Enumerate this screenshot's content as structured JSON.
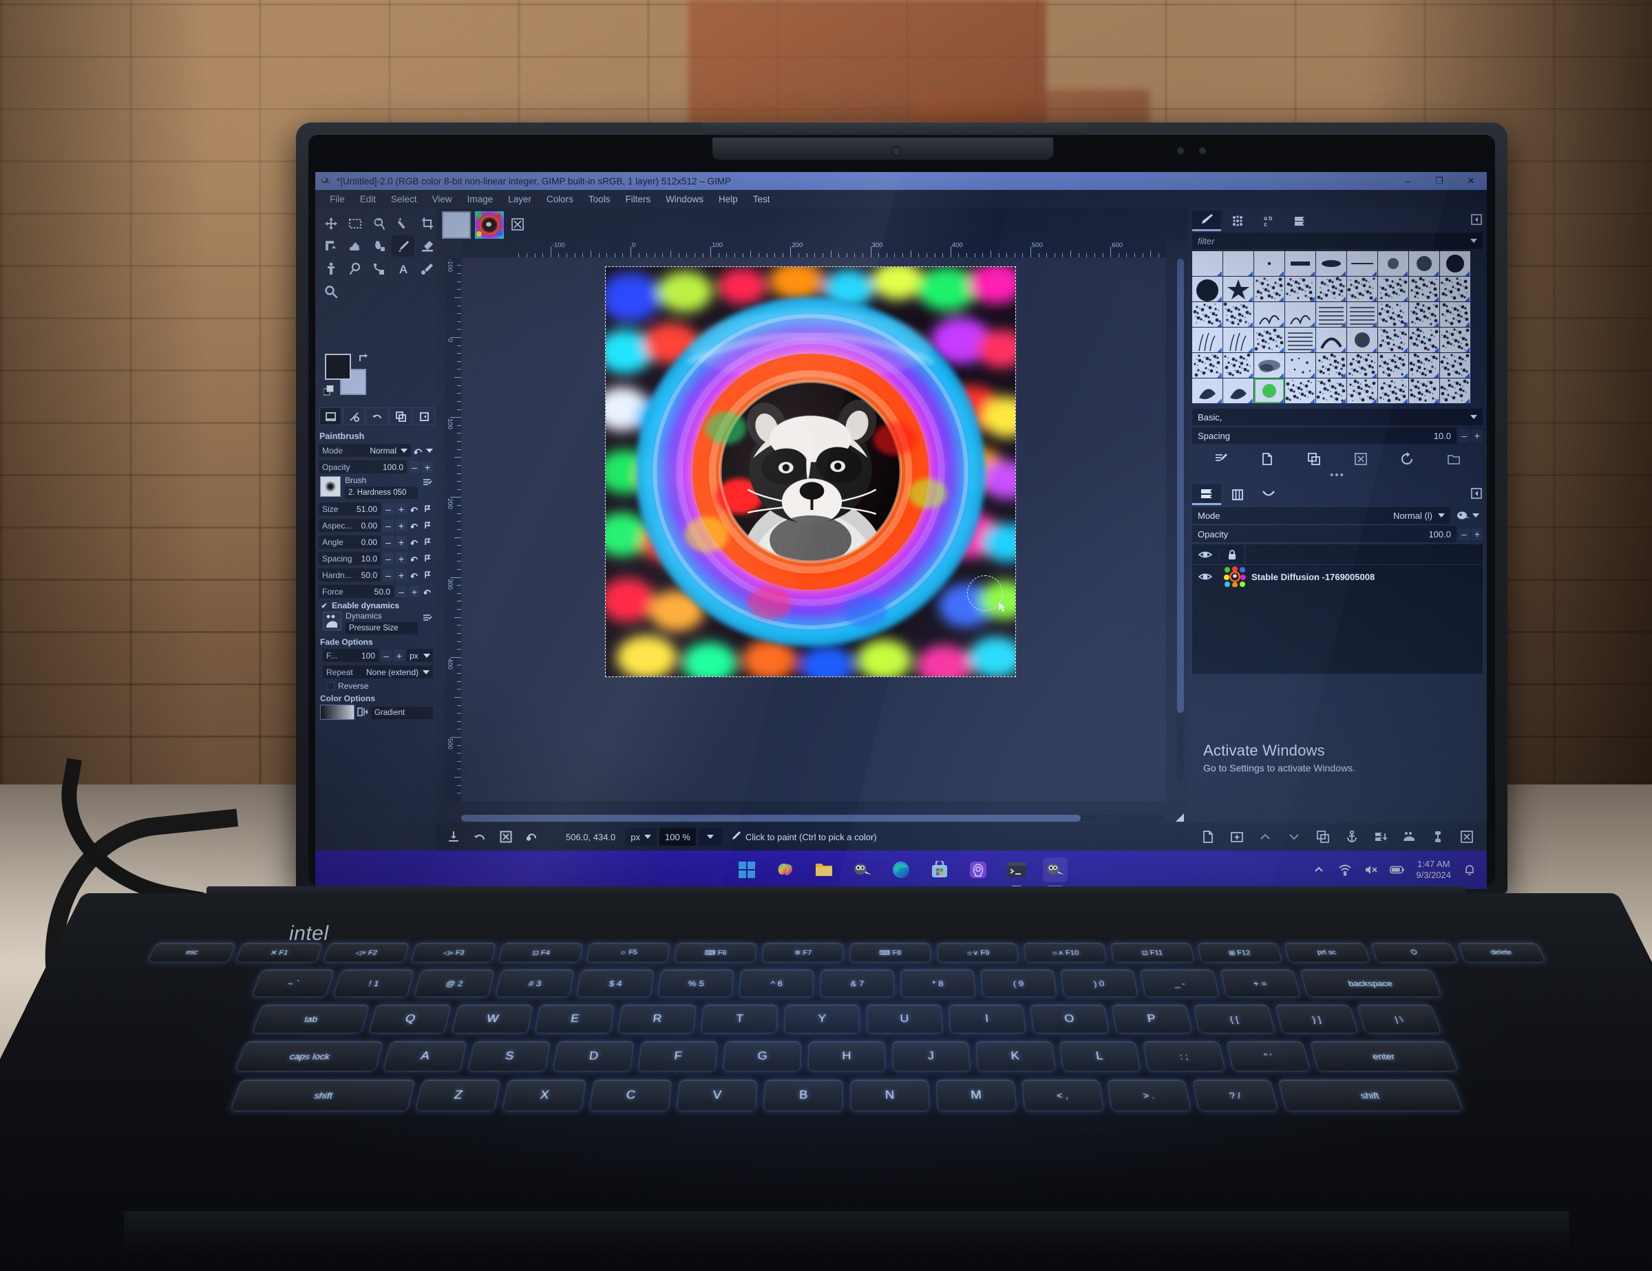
{
  "window": {
    "title": "*[Untitled]-2.0 (RGB color 8-bit non-linear integer, GIMP built-in sRGB, 1 layer) 512x512 – GIMP",
    "minimize": "–",
    "maximize": "❐",
    "close": "✕"
  },
  "menubar": {
    "items": [
      "File",
      "Edit",
      "Select",
      "View",
      "Image",
      "Layer",
      "Colors",
      "Tools",
      "Filters",
      "Windows",
      "Help",
      "Test"
    ]
  },
  "toolbox": {
    "tools": [
      {
        "name": "move-tool",
        "label": "Move"
      },
      {
        "name": "rectangle-select-tool",
        "label": "Rectangle Select"
      },
      {
        "name": "free-select-tool",
        "label": "Free Select"
      },
      {
        "name": "fuzzy-select-tool",
        "label": "Fuzzy Select"
      },
      {
        "name": "crop-tool",
        "label": "Crop"
      },
      {
        "name": "transform-tool",
        "label": "Unified Transform"
      },
      {
        "name": "bucket-fill-tool",
        "label": "Bucket Fill"
      },
      {
        "name": "smudge-tool",
        "label": "Smudge"
      },
      {
        "name": "paintbrush-tool",
        "label": "Paintbrush"
      },
      {
        "name": "eraser-tool",
        "label": "Eraser"
      },
      {
        "name": "clone-tool",
        "label": "Clone"
      },
      {
        "name": "heal-tool",
        "label": "Heal"
      },
      {
        "name": "path-tool",
        "label": "Paths"
      },
      {
        "name": "text-tool",
        "label": "Text"
      },
      {
        "name": "color-picker-tool",
        "label": "Color Picker"
      },
      {
        "name": "zoom-tool",
        "label": "Zoom"
      }
    ],
    "active_tool": "paintbrush-tool",
    "colors": {
      "foreground": "#0a0f1c",
      "background": "#b6c9ef"
    },
    "quick_buttons": [
      "image-window",
      "quick-mask",
      "undo-history",
      "duplicate",
      "shrink-wrap"
    ]
  },
  "tool_options": {
    "title": "Paintbrush",
    "mode_label": "Mode",
    "mode_value": "Normal",
    "opacity_label": "Opacity",
    "opacity_value": "100.0",
    "brush_label": "Brush",
    "brush_name": "2. Hardness 050",
    "size_label": "Size",
    "size_value": "51.00",
    "aspect_label": "Aspec...",
    "aspect_value": "0.00",
    "angle_label": "Angle",
    "angle_value": "0.00",
    "spacing_label": "Spacing",
    "spacing_value": "10.0",
    "hardness_label": "Hardn...",
    "hardness_value": "50.0",
    "force_label": "Force",
    "force_value": "50.0",
    "enable_dynamics_label": "Enable dynamics",
    "enable_dynamics_checked": true,
    "dynamics_label": "Dynamics",
    "dynamics_value": "Pressure Size",
    "fade_options_label": "Fade Options",
    "fade_label": "F...",
    "fade_value": "100",
    "fade_unit": "px",
    "repeat_label": "Repeat",
    "repeat_value": "None (extend)",
    "reverse_label": "Reverse",
    "reverse_checked": false,
    "color_options_label": "Color Options",
    "gradient_label": "Gradient"
  },
  "canvas": {
    "ruler_h_labels": [
      "-100",
      "0",
      "100",
      "200",
      "300",
      "400",
      "500",
      "600"
    ],
    "ruler_v_labels": [
      "-100",
      "0",
      "100",
      "200",
      "300",
      "400",
      "500"
    ],
    "image_alt": "raccoon-in-candy-jar"
  },
  "statusbar": {
    "icons": [
      "save-icon",
      "undo-icon",
      "cancel-icon",
      "revert-icon"
    ],
    "position": "506.0, 434.0",
    "unit": "px",
    "zoom": "100 %",
    "hint": "Click to paint (Ctrl to pick a color)"
  },
  "right_dock": {
    "tabs": [
      {
        "name": "brushes-tab",
        "icon": "paintbrush-icon"
      },
      {
        "name": "patterns-tab",
        "icon": "pattern-icon"
      },
      {
        "name": "fonts-tab",
        "icon": "ab-icon"
      },
      {
        "name": "document-history-tab",
        "icon": "stack-icon"
      }
    ],
    "active_tab": "brushes-tab",
    "filter_placeholder": "filter",
    "brush_set_value": "Basic,",
    "spacing_label": "Spacing",
    "spacing_value": "10.0",
    "brush_action_icons": [
      "edit-brush-icon",
      "new-brush-icon",
      "duplicate-brush-icon",
      "delete-brush-icon",
      "refresh-brushes-icon",
      "open-folder-icon"
    ],
    "dots": "•••"
  },
  "layers": {
    "tabs": [
      {
        "name": "layers-tab",
        "icon": "layers-icon"
      },
      {
        "name": "channels-tab",
        "icon": "channels-icon"
      },
      {
        "name": "paths-tab",
        "icon": "paths-icon"
      }
    ],
    "active_tab": "layers-tab",
    "mode_label": "Mode",
    "mode_value": "Normal (l)",
    "opacity_label": "Opacity",
    "opacity_value": "100.0",
    "rows": [
      {
        "name": "Stable Diffusion -1769005008",
        "visible": true,
        "locked": false
      }
    ],
    "bottom_icons": [
      "new-layer-icon",
      "new-group-icon",
      "raise-layer-icon",
      "lower-layer-icon",
      "duplicate-layer-icon",
      "anchor-layer-icon",
      "merge-down-icon",
      "mask-icon",
      "lock-alpha-icon",
      "delete-layer-icon"
    ]
  },
  "watermark": {
    "title": "Activate Windows",
    "subtitle": "Go to Settings to activate Windows."
  },
  "taskbar": {
    "apps": [
      {
        "name": "start-button",
        "icon": "windows-logo"
      },
      {
        "name": "copilot-button",
        "icon": "copilot-icon"
      },
      {
        "name": "file-explorer-button",
        "icon": "folder-icon"
      },
      {
        "name": "gimp-button",
        "icon": "gimp-icon"
      },
      {
        "name": "edge-button",
        "icon": "edge-icon"
      },
      {
        "name": "store-button",
        "icon": "store-icon"
      },
      {
        "name": "ai-app-button",
        "icon": "brain-icon"
      },
      {
        "name": "terminal-button",
        "icon": "terminal-icon"
      },
      {
        "name": "gimp-active-button",
        "icon": "gimp-icon"
      }
    ],
    "tray": {
      "chevron": "^",
      "wifi": "wifi-icon",
      "volume": "volume-muted-icon",
      "battery": "battery-icon",
      "time": "1:47 AM",
      "date": "9/3/2024",
      "notifications": "bell-icon"
    }
  },
  "laptop": {
    "brand": "intel"
  }
}
